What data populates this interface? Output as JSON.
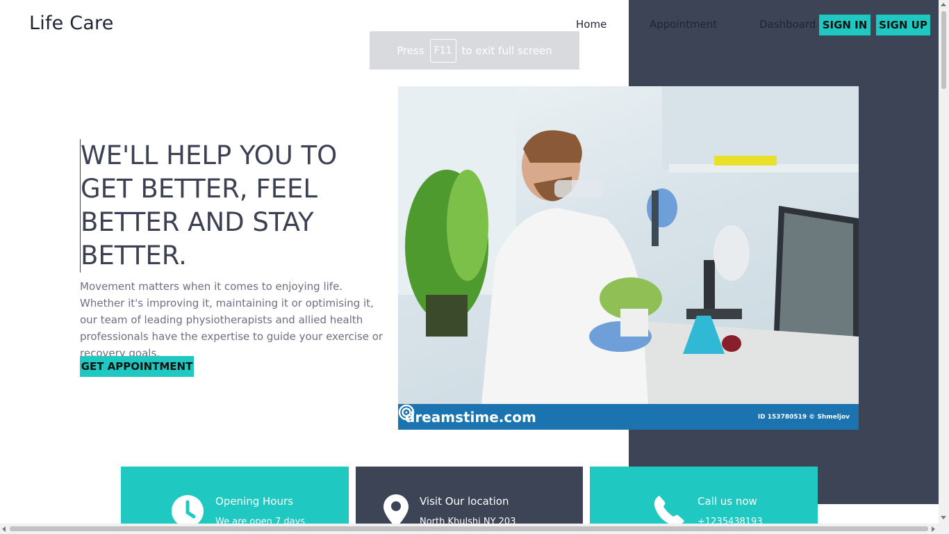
{
  "header": {
    "logo": "Life Care",
    "nav": {
      "home": "Home",
      "appointment": "Appointment",
      "dashboard": "Dashboard"
    },
    "sign_in": "SIGN IN",
    "sign_up": "SIGN UP"
  },
  "fullscreen_notice": {
    "press": "Press",
    "key": "F11",
    "rest": "to exit full screen"
  },
  "hero": {
    "title": "WE'LL HELP YOU TO GET BETTER, FEEL BETTER AND STAY BETTER.",
    "text": "Movement matters when it comes to enjoying life. Whether it's improving it, maintaining it or optimising it, our team of leading physiotherapists and allied health professionals have the expertise to guide your exercise or recovery goals.",
    "button": "GET APPOINTMENT",
    "image": {
      "brand": "dreamstime.com",
      "id_text": "ID 153780519 © Shmeljov"
    }
  },
  "cards": [
    {
      "title": "Opening Hours",
      "subtitle": "We are open 7 days",
      "icon": "clock-icon"
    },
    {
      "title": "Visit Our location",
      "subtitle": "North Khulshi NY 203",
      "icon": "map-pin-icon"
    },
    {
      "title": "Call us now",
      "subtitle": "+1235438193",
      "icon": "phone-icon"
    }
  ],
  "colors": {
    "accent": "#1fc8c0",
    "dark": "#3d4456",
    "text": "#3b4152",
    "image_bar": "#1b74b0"
  }
}
